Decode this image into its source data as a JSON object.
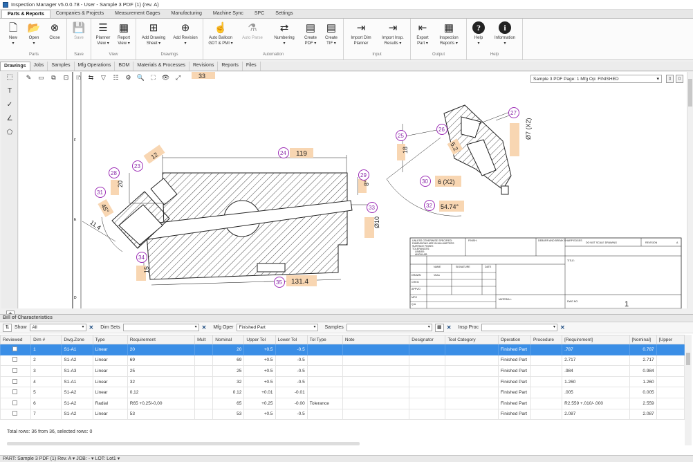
{
  "app_title": "Inspection Manager v5.0.0.78 - User - Sample 3 PDF (1) (rev. A)",
  "menu_tabs": [
    "Parts & Reports",
    "Companies & Projects",
    "Measurement Gages",
    "Manufacturing",
    "Machine Sync",
    "SPC",
    "Settings"
  ],
  "ribbon": {
    "groups": [
      {
        "label": "Parts",
        "buttons": [
          {
            "label": "New\n▾",
            "icon": "new-icon"
          },
          {
            "label": "Open\n▾",
            "icon": "open-folder-icon"
          },
          {
            "label": "Close",
            "icon": "close-doc-icon"
          }
        ]
      },
      {
        "label": "Save",
        "buttons": [
          {
            "label": "Save",
            "icon": "save-icon"
          }
        ]
      },
      {
        "label": "View",
        "buttons": [
          {
            "label": "Planner\nView ▾",
            "icon": "planner-view-icon"
          },
          {
            "label": "Report\nView ▾",
            "icon": "report-view-icon"
          }
        ]
      },
      {
        "label": "Drawings",
        "buttons": [
          {
            "label": "Add Drawing\nSheet ▾",
            "icon": "add-sheet-icon"
          },
          {
            "label": "Add Revision\n▾",
            "icon": "add-revision-icon"
          }
        ]
      },
      {
        "label": "Automation",
        "buttons": [
          {
            "label": "Auto Balloon\nGDT & PMI ▾",
            "icon": "auto-balloon-icon"
          },
          {
            "label": "Auto Parse",
            "icon": "auto-parse-icon"
          },
          {
            "label": "Numbering\n▾",
            "icon": "numbering-icon"
          },
          {
            "label": "Create\nPDF ▾",
            "icon": "pdf-icon"
          },
          {
            "label": "Create\nTIF ▾",
            "icon": "tif-icon"
          }
        ]
      },
      {
        "label": "Input",
        "buttons": [
          {
            "label": "Import Dim\nPlanner",
            "icon": "import-planner-icon"
          },
          {
            "label": "Import Insp.\nResults ▾",
            "icon": "import-results-icon"
          }
        ]
      },
      {
        "label": "Output",
        "buttons": [
          {
            "label": "Export\nPart ▾",
            "icon": "export-icon"
          },
          {
            "label": "Inspection\nReports ▾",
            "icon": "inspection-reports-icon"
          }
        ]
      },
      {
        "label": "Help",
        "buttons": [
          {
            "label": "Help\n▾",
            "icon": "help-icon"
          },
          {
            "label": "Information\n▾",
            "icon": "info-icon"
          }
        ]
      }
    ]
  },
  "doc_tabs": [
    "Drawings",
    "Jobs",
    "Samples",
    "Mfg Operations",
    "BOM",
    "Materials & Processes",
    "Revisions",
    "Reports",
    "Files"
  ],
  "page_selector": "Sample 3 PDF Page: 1 Mfg Op: FINISHED",
  "drawing": {
    "balloons": [
      {
        "n": "23",
        "label": "12"
      },
      {
        "n": "24",
        "label": "119"
      },
      {
        "n": "25",
        "label": "18"
      },
      {
        "n": "26",
        "label": "5.2"
      },
      {
        "n": "27",
        "label": "Ø7 (X2)"
      },
      {
        "n": "28",
        "label": "20"
      },
      {
        "n": "29",
        "label": "8°"
      },
      {
        "n": "30",
        "label": "6 (X2)"
      },
      {
        "n": "31",
        "label": "45°"
      },
      {
        "n": "32",
        "label": "54.74°"
      },
      {
        "n": "33",
        "label": "Ø10"
      },
      {
        "n": "34",
        "label": "15"
      },
      {
        "n": "35",
        "label": "131.4"
      }
    ],
    "top_cut_label": "33",
    "margin_letters": [
      "F",
      "E",
      "D"
    ],
    "titleblock": {
      "notes": [
        "UNLESS OTHERWISE SPECIFIED:",
        "DIMENSIONS ARE IN MILLIMETERS",
        "SURFACE FINISH:",
        "TOLERANCES:",
        "LINEAR:",
        "ANGULAR:"
      ],
      "finish": "FINISH:",
      "deburr": "DEBURR AND BREAK SHARP EDGES",
      "do_not_scale": "DO NOT SCALE DRAWING",
      "revision": "REVISION",
      "rev_value": "A",
      "title": "TITLE:",
      "name": "NAME",
      "signature": "SIGNATURE",
      "date": "DATE",
      "rows": [
        "DRAWN",
        "CHK'D",
        "APPV'D",
        "MFG",
        "Q.A"
      ],
      "drawn_by": "Vishu",
      "material": "MATERIAL:",
      "dwg_no": "DWG NO.",
      "sheet": "1"
    }
  },
  "bom": {
    "title": "Bill of Characteristics",
    "filters": {
      "show_label": "Show",
      "show_value": "All",
      "dimsets_label": "Dim Sets",
      "dimsets_value": "",
      "mfgoper_label": "Mfg Oper",
      "mfgoper_value": "Finished Part",
      "samples_label": "Samples",
      "samples_value": "",
      "inspproc_label": "Insp Proc",
      "inspproc_value": ""
    },
    "columns": [
      "Reviewed",
      "Dim #",
      "Dwg.Zone",
      "Type",
      "Requirement",
      "Mult",
      "Nominal",
      "Upper Tol",
      "Lower Tol",
      "Tol Type",
      "Note",
      "Designator",
      "Tool Category",
      "Operation",
      "Procedure",
      "[Requirement]",
      "[Nominal]",
      "[Upper"
    ],
    "rows": [
      {
        "dim": "1",
        "zone": "S1-A1",
        "type": "Linear",
        "req": "20",
        "mult": "",
        "nom": "20",
        "upt": "+0.5",
        "lot": "-0.5",
        "toltype": "",
        "op": "Finished Part",
        "breq": ".787",
        "bnom": "0.787"
      },
      {
        "dim": "2",
        "zone": "S1-A2",
        "type": "Linear",
        "req": "69",
        "mult": "",
        "nom": "69",
        "upt": "+0.5",
        "lot": "-0.5",
        "toltype": "",
        "op": "Finished Part",
        "breq": "2.717",
        "bnom": "2.717"
      },
      {
        "dim": "3",
        "zone": "S1-A3",
        "type": "Linear",
        "req": "25",
        "mult": "",
        "nom": "25",
        "upt": "+0.5",
        "lot": "-0.5",
        "toltype": "",
        "op": "Finished Part",
        "breq": ".984",
        "bnom": "0.984"
      },
      {
        "dim": "4",
        "zone": "S1-A1",
        "type": "Linear",
        "req": "32",
        "mult": "",
        "nom": "32",
        "upt": "+0.5",
        "lot": "-0.5",
        "toltype": "",
        "op": "Finished Part",
        "breq": "1.260",
        "bnom": "1.260"
      },
      {
        "dim": "5",
        "zone": "S1-A2",
        "type": "Linear",
        "req": "0,12",
        "mult": "",
        "nom": "0.12",
        "upt": "+0.01",
        "lot": "-0.01",
        "toltype": "",
        "op": "Finished Part",
        "breq": ".005",
        "bnom": "0.005"
      },
      {
        "dim": "6",
        "zone": "S1-A2",
        "type": "Radial",
        "req": "R65  +0,25/-0,00",
        "mult": "",
        "nom": "65",
        "upt": "+0.25",
        "lot": "-0.00",
        "toltype": "Tolerance",
        "op": "Finished Part",
        "breq": "R2.559  +.010/-.000",
        "bnom": "2.559"
      },
      {
        "dim": "7",
        "zone": "S1-A2",
        "type": "Linear",
        "req": "53",
        "mult": "",
        "nom": "53",
        "upt": "+0.5",
        "lot": "-0.5",
        "toltype": "",
        "op": "Finished Part",
        "breq": "2.087",
        "bnom": "2.087"
      }
    ],
    "total_rows": "Total rows: 36 from 36, selected rows: 0"
  },
  "status_bar": "PART: Sample 3 PDF (1) Rev. A  ▾  JOB: -  ▾  LOT: Lot1  ▾"
}
